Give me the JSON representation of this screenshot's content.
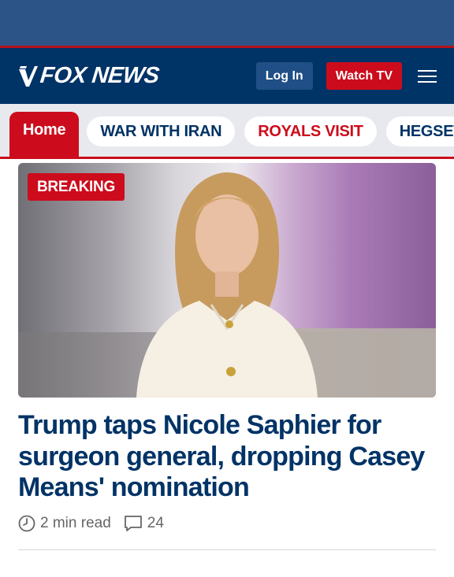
{
  "brand": {
    "logo_text": "FOX NEWS"
  },
  "header": {
    "login_label": "Log In",
    "watch_label": "Watch TV"
  },
  "nav": {
    "home_label": "Home",
    "items": [
      {
        "label": "WAR WITH IRAN"
      },
      {
        "label": "ROYALS VISIT"
      },
      {
        "label": "HEGSETH"
      }
    ]
  },
  "story": {
    "badge": "BREAKING",
    "headline": "Trump taps Nicole Saphier for surgeon general, dropping Casey Means' nomination",
    "read_time": "2 min read",
    "comment_count": "24"
  },
  "colors": {
    "brand_navy": "#003366",
    "brand_red": "#cc0c1c",
    "ad_blue": "#2d5487"
  }
}
